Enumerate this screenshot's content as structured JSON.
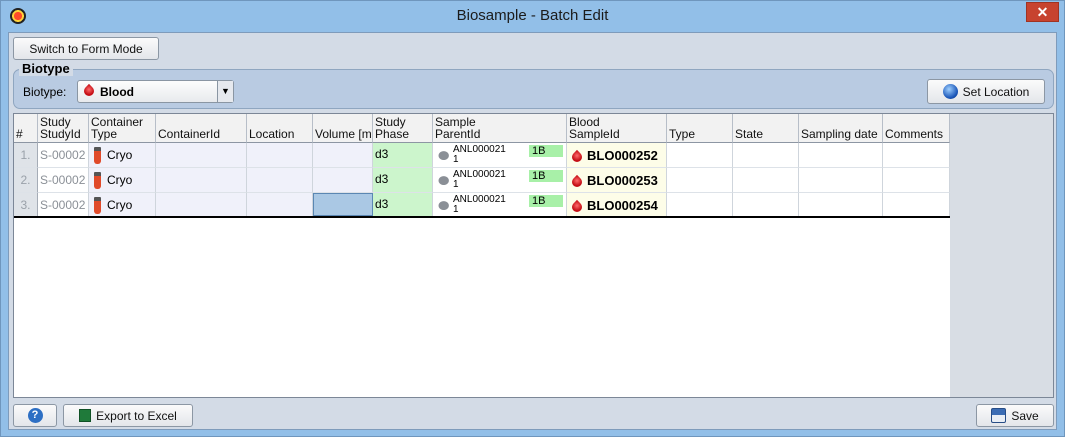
{
  "window": {
    "title": "Biosample - Batch Edit",
    "close_glyph": "✕"
  },
  "toolbar": {
    "switch_label": "Switch to Form Mode"
  },
  "biotype": {
    "group_title": "Biotype",
    "label": "Biotype:",
    "value": "Blood",
    "arrow": "▼",
    "set_location_label": "Set Location"
  },
  "table": {
    "headers": {
      "num": "#",
      "study_top": "Study",
      "study_bottom": "StudyId",
      "container_top": "Container",
      "container_bottom": "Type",
      "containerid": "ContainerId",
      "location": "Location",
      "volume": "Volume [m",
      "phase_top": "Study",
      "phase_bottom": "Phase",
      "parent_top": "Sample",
      "parent_bottom": "ParentId",
      "blood_top": "Blood",
      "blood_bottom": "SampleId",
      "type": "Type",
      "state": "State",
      "sampling_date": "Sampling date",
      "comments": "Comments"
    },
    "rows": [
      {
        "num": "1.",
        "study_id": "S-00002",
        "container": "Cryo",
        "phase": "d3",
        "parent_line1": "ANL000021",
        "parent_line2": "1",
        "parent_badge": "1B",
        "sample_id": "BLO000252"
      },
      {
        "num": "2.",
        "study_id": "S-00002",
        "container": "Cryo",
        "phase": "d3",
        "parent_line1": "ANL000021",
        "parent_line2": "1",
        "parent_badge": "1B",
        "sample_id": "BLO000253"
      },
      {
        "num": "3.",
        "study_id": "S-00002",
        "container": "Cryo",
        "phase": "d3",
        "parent_line1": "ANL000021",
        "parent_line2": "1",
        "parent_badge": "1B",
        "sample_id": "BLO000254"
      }
    ]
  },
  "footer": {
    "help_glyph": "?",
    "export_label": "Export to Excel",
    "save_label": "Save"
  }
}
